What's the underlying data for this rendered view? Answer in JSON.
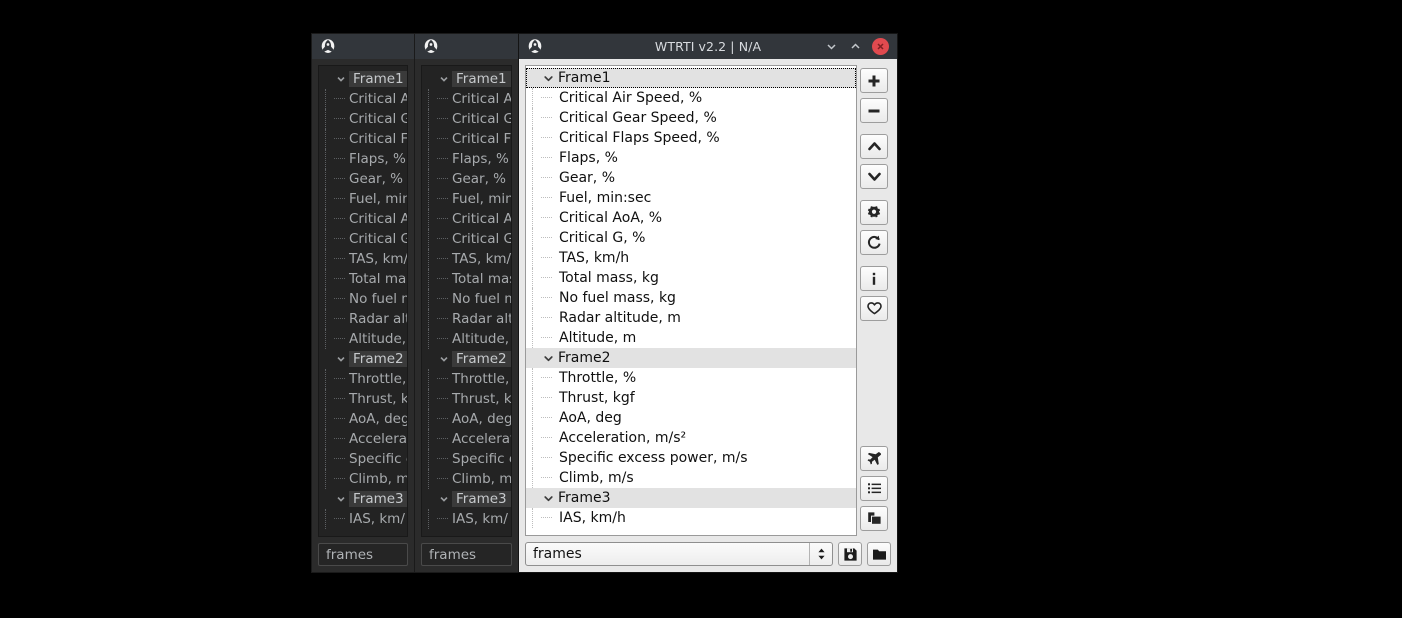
{
  "windows": {
    "back1": {
      "title": "",
      "icon": "app-emblem-icon",
      "combo_value": "frames"
    },
    "back2": {
      "title": "",
      "icon": "app-emblem-icon",
      "combo_value": "frames"
    },
    "main": {
      "title": "WTRTI v2.2 | N/A",
      "icon": "app-emblem-icon",
      "buttons": {
        "minimize": "chevron-down-icon",
        "maximize": "chevron-up-icon",
        "close": "close-icon"
      },
      "combo_value": "frames",
      "save_label": "save-icon",
      "open_label": "folder-icon"
    }
  },
  "tree": [
    {
      "level": 0,
      "label": "Frame1",
      "state": "expanded",
      "selected": true
    },
    {
      "level": 1,
      "label": "Critical Air Speed, %"
    },
    {
      "level": 1,
      "label": "Critical Gear Speed, %"
    },
    {
      "level": 1,
      "label": "Critical Flaps Speed, %"
    },
    {
      "level": 1,
      "label": "Flaps, %"
    },
    {
      "level": 1,
      "label": "Gear, %"
    },
    {
      "level": 1,
      "label": "Fuel, min:sec"
    },
    {
      "level": 1,
      "label": "Critical AoA, %"
    },
    {
      "level": 1,
      "label": "Critical G, %"
    },
    {
      "level": 1,
      "label": "TAS, km/h"
    },
    {
      "level": 1,
      "label": "Total mass, kg"
    },
    {
      "level": 1,
      "label": "No fuel mass, kg"
    },
    {
      "level": 1,
      "label": "Radar altitude, m"
    },
    {
      "level": 1,
      "label": "Altitude, m"
    },
    {
      "level": 0,
      "label": "Frame2",
      "state": "expanded"
    },
    {
      "level": 1,
      "label": "Throttle, %"
    },
    {
      "level": 1,
      "label": "Thrust, kgf"
    },
    {
      "level": 1,
      "label": "AoA, deg"
    },
    {
      "level": 1,
      "label": "Acceleration, m/s²"
    },
    {
      "level": 1,
      "label": "Specific excess power, m/s"
    },
    {
      "level": 1,
      "label": "Climb, m/s"
    },
    {
      "level": 0,
      "label": "Frame3",
      "state": "expanded"
    },
    {
      "level": 1,
      "label": "IAS, km/h"
    }
  ],
  "toolbar": {
    "top_items": [
      {
        "name": "add-button",
        "icon": "plus-icon"
      },
      {
        "name": "remove-button",
        "icon": "minus-icon"
      },
      {
        "name": "move-up-button",
        "icon": "chevron-up-icon"
      },
      {
        "name": "move-down-button",
        "icon": "chevron-down-icon"
      },
      {
        "name": "settings-button",
        "icon": "gear-icon"
      },
      {
        "name": "refresh-button",
        "icon": "refresh-icon"
      },
      {
        "name": "info-button",
        "icon": "info-icon"
      },
      {
        "name": "favorite-button",
        "icon": "heart-icon"
      }
    ],
    "bottom_items": [
      {
        "name": "aircraft-button",
        "icon": "airplane-icon"
      },
      {
        "name": "list-button",
        "icon": "list-icon"
      },
      {
        "name": "windows-button",
        "icon": "windows-icon"
      }
    ]
  },
  "colors": {
    "titlebar": "#32363b",
    "close": "#e04a4f",
    "dark_panel": "#232323",
    "light_panel": "#ffffff",
    "group_highlight": "#e2e2e2",
    "chrome": "#e8e8e8"
  }
}
